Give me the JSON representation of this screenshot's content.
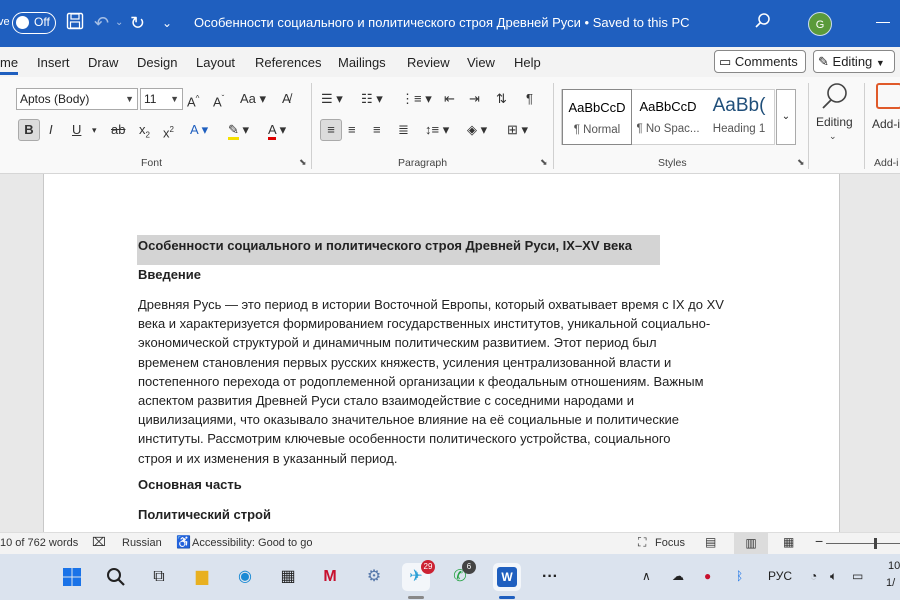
{
  "titlebar": {
    "autosave_label": "ve",
    "autosave_state": "Off",
    "doc_title": "Особенности социального и политического строя Древней Руси",
    "save_status": "Saved to this PC",
    "separator": "•",
    "user_initial": "G",
    "brand_color": "#1f5fbf"
  },
  "tabs": {
    "items": [
      "me",
      "Insert",
      "Draw",
      "Design",
      "Layout",
      "References",
      "Mailings",
      "Review",
      "View",
      "Help"
    ],
    "comments_label": "Comments",
    "editing_label": "Editing"
  },
  "ribbon": {
    "font_name": "Aptos (Body)",
    "font_size": "11",
    "group_font": "Font",
    "group_paragraph": "Paragraph",
    "group_styles": "Styles",
    "group_addins": "Add-i",
    "styles": [
      {
        "preview": "AaBbCcD",
        "name": "¶ Normal"
      },
      {
        "preview": "AaBbCcD",
        "name": "¶ No Spac..."
      },
      {
        "preview": "AaBb(",
        "name": "Heading 1"
      }
    ],
    "editing_button": "Editing",
    "addins_button": "Add-i"
  },
  "document": {
    "title": "Особенности социального и политического строя Древней Руси, IX–XV века",
    "h_intro": "Введение",
    "intro_lines": [
      "Древняя Русь — это период в истории Восточной Европы, который охватывает время с IX до XV",
      "века и характеризуется формированием государственных институтов, уникальной социально-",
      "экономической структурой и динамичным политическим развитием. Этот период был",
      "временем становления первых русских княжеств, усиления централизованной власти и",
      "постепенного перехода от родоплеменной организации к феодальным отношениям. Важным",
      "аспектом развития Древней Руси стало взаимодействие с соседними народами и",
      "цивилизациями, что оказывало значительное влияние на её социальные и политические",
      "институты. Рассмотрим ключевые особенности политического устройства, социального",
      "строя и их изменения в указанный период."
    ],
    "h_main": "Основная часть",
    "h_political": "Политический строй"
  },
  "statusbar": {
    "word_count": "10 of 762 words",
    "language": "Russian",
    "accessibility": "Accessibility: Good to go",
    "focus": "Focus"
  },
  "taskbar": {
    "telegram_badge": "29",
    "whatsapp_badge": "6",
    "language": "РУС",
    "time": "10",
    "date": "1/"
  }
}
